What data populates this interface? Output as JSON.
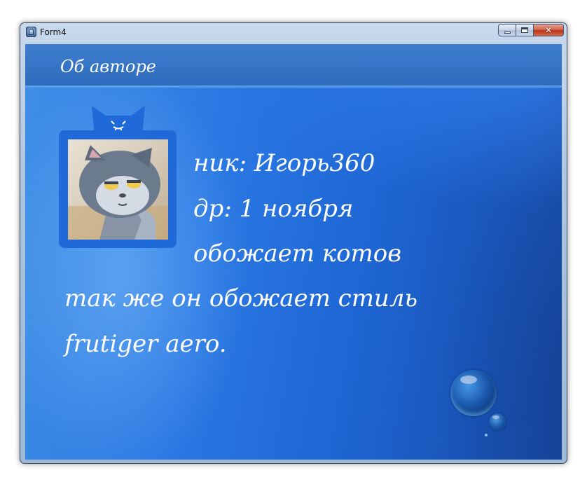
{
  "window": {
    "title": "Form4",
    "controls": {
      "minimize_icon": "minimize-icon",
      "maximize_icon": "maximize-icon",
      "close_label": "✕"
    }
  },
  "header": {
    "title": "Об авторе"
  },
  "profile": {
    "avatar_icon": "cat-ears-icon",
    "lines": [
      "ник: Игорь360",
      "др: 1 ноября",
      "обожает котов"
    ],
    "about_line_1": "так же он обожает стиль",
    "about_line_2": "frutiger aero."
  },
  "colors": {
    "background": "#2a78e3",
    "header": "#3a78c8",
    "frame": "#1f6ad8",
    "text": "#ffffff"
  }
}
